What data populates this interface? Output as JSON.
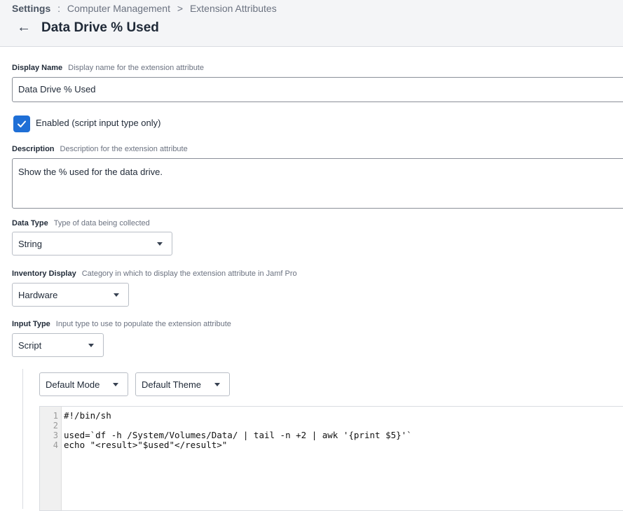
{
  "breadcrumb": {
    "root": "Settings",
    "sep1": ":",
    "item1": "Computer Management",
    "sep2": ">",
    "item2": "Extension Attributes"
  },
  "page": {
    "title": "Data Drive % Used"
  },
  "display_name": {
    "label": "Display Name",
    "help": "Display name for the extension attribute",
    "value": "Data Drive % Used"
  },
  "enabled": {
    "label": "Enabled (script input type only)",
    "checked": true
  },
  "description": {
    "label": "Description",
    "help": "Description for the extension attribute",
    "value": "Show the % used for the data drive."
  },
  "data_type": {
    "label": "Data Type",
    "help": "Type of data being collected",
    "value": "String"
  },
  "inventory_display": {
    "label": "Inventory Display",
    "help": "Category in which to display the extension attribute in Jamf Pro",
    "value": "Hardware"
  },
  "input_type": {
    "label": "Input Type",
    "help": "Input type to use to populate the extension attribute",
    "value": "Script"
  },
  "editor": {
    "mode": "Default Mode",
    "theme": "Default Theme",
    "line_numbers": [
      "1",
      "2",
      "3",
      "4"
    ],
    "lines": [
      "#!/bin/sh",
      "",
      "used=`df -h /System/Volumes/Data/ | tail -n +2 | awk '{print $5}'`",
      "echo \"<result>\"$used\"</result>\""
    ]
  },
  "colors": {
    "accent": "#1f6fd6",
    "header_bg": "#f4f5f7"
  }
}
